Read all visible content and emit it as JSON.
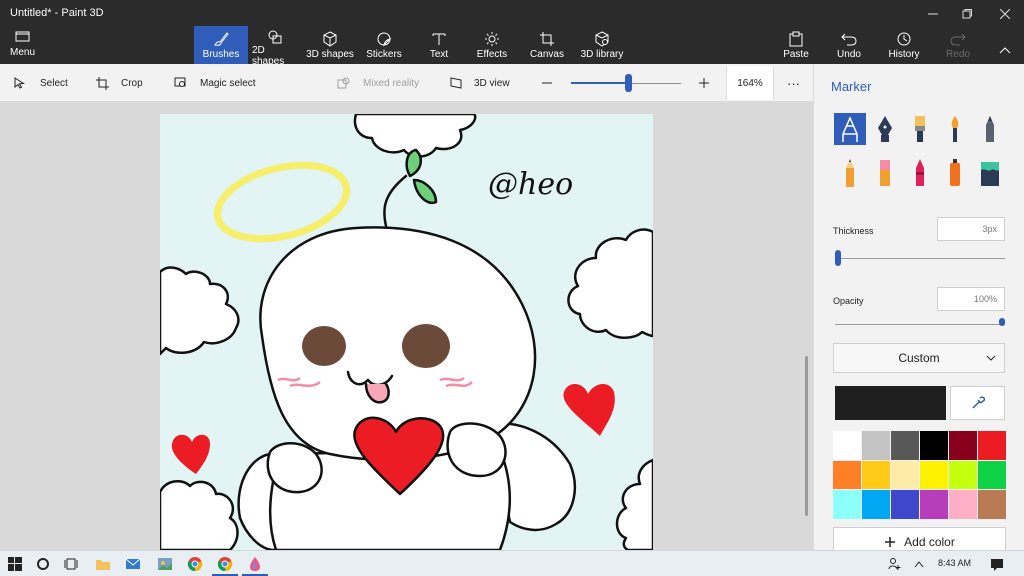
{
  "window": {
    "title": "Untitled* - Paint 3D",
    "controls": [
      "—",
      "❐",
      "✕"
    ]
  },
  "ribbon": {
    "menu_label": "Menu",
    "tools": [
      {
        "label": "Brushes",
        "icon": "brush-icon",
        "active": true
      },
      {
        "label": "2D shapes",
        "icon": "2d-shapes-icon"
      },
      {
        "label": "3D shapes",
        "icon": "3d-shapes-icon"
      },
      {
        "label": "Stickers",
        "icon": "stickers-icon"
      },
      {
        "label": "Text",
        "icon": "text-icon"
      },
      {
        "label": "Effects",
        "icon": "effects-icon"
      },
      {
        "label": "Canvas",
        "icon": "canvas-icon"
      },
      {
        "label": "3D library",
        "icon": "3d-library-icon"
      }
    ],
    "right_tools": [
      {
        "label": "Paste",
        "icon": "paste-icon"
      },
      {
        "label": "Undo",
        "icon": "undo-icon"
      },
      {
        "label": "History",
        "icon": "history-icon"
      },
      {
        "label": "Redo",
        "icon": "redo-icon",
        "disabled": true
      }
    ]
  },
  "subbar": {
    "select": "Select",
    "crop": "Crop",
    "magic_select": "Magic select",
    "mixed_reality": "Mixed reality",
    "view_3d": "3D view",
    "zoom_value": "164%",
    "zoom_level": 0.52,
    "more": "···"
  },
  "canvas": {
    "signature": "@heo"
  },
  "panel": {
    "title": "Marker",
    "brushes": [
      "marker-icon",
      "calligraphy-pen-icon",
      "oil-brush-icon",
      "watercolor-icon",
      "pixel-pen-icon",
      "pencil-icon",
      "eraser-icon",
      "crayon-icon",
      "spray-can-icon",
      "fill-icon"
    ],
    "thickness_label": "Thickness",
    "thickness_value": "3px",
    "thickness_level": 0.0,
    "opacity_label": "Opacity",
    "opacity_value": "100%",
    "opacity_level": 1.0,
    "color_mode": "Custom",
    "current_color": "#1f1f1f",
    "palette": [
      "#ffffff",
      "#c3c3c3",
      "#585858",
      "#000000",
      "#88001b",
      "#ec1c24",
      "#ff7f27",
      "#ffca18",
      "#fdeca6",
      "#fff200",
      "#c4ff0e",
      "#0ed145",
      "#8cfffb",
      "#00a8f3",
      "#3f48cc",
      "#b83dba",
      "#ffaec8",
      "#b97a56"
    ],
    "add_color": "Add color"
  },
  "taskbar": {
    "time": "8:43 AM"
  }
}
